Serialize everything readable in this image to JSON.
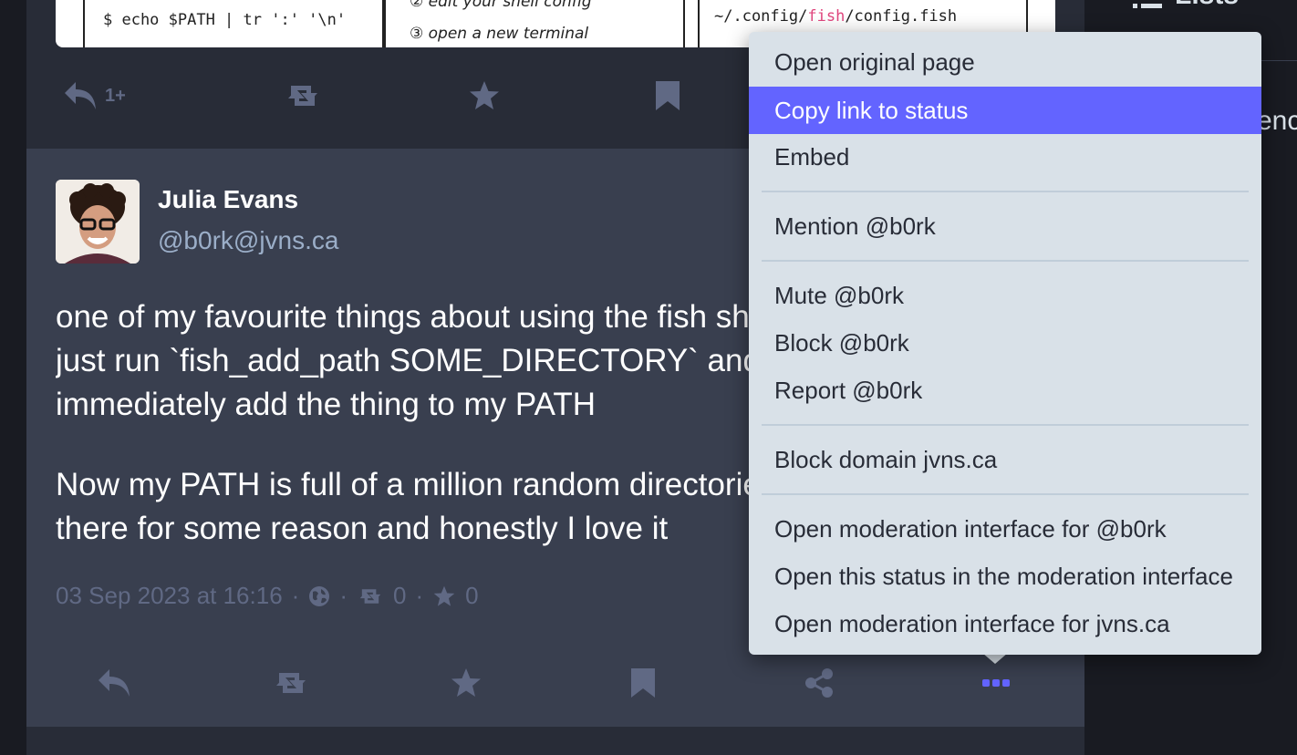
{
  "right_sidebar": {
    "lists_label": "Lists",
    "peek_text": "enc"
  },
  "media_card": {
    "panel1_code": "$ echo $PATH | tr ':' '\\n'",
    "panel2_line1": "② edit your shell config",
    "panel2_line2": "③ open a new terminal",
    "panel3_prefix": "~/.config/",
    "panel3_fish": "fish",
    "panel3_suffix": "/config.fish"
  },
  "prev_actions": {
    "reply_count": "1+"
  },
  "status": {
    "display_name": "Julia Evans",
    "account": "@b0rk@jvns.ca",
    "paragraph1_lines": [
      "one of my favourite things about using the fish shell is that I can",
      "just run `fish_add_path SOME_DIRECTORY` and it'll",
      "immediately add the thing to my PATH"
    ],
    "paragraph2_lines": [
      "Now my PATH is full of a million random directories that are in",
      "there for some reason and honestly I love it"
    ],
    "timestamp": "03 Sep 2023 at 16:16",
    "separator": "·",
    "boost_count": "0",
    "fav_count": "0"
  },
  "dropdown": {
    "items": [
      {
        "label": "Open original page",
        "active": false
      },
      {
        "label": "Copy link to status",
        "active": true
      },
      {
        "label": "Embed",
        "active": false
      },
      {
        "label": "Mention @b0rk",
        "active": false
      },
      {
        "label": "Mute @b0rk",
        "active": false
      },
      {
        "label": "Block @b0rk",
        "active": false
      },
      {
        "label": "Report @b0rk",
        "active": false
      },
      {
        "label": "Block domain jvns.ca",
        "active": false
      },
      {
        "label": "Open moderation interface for @b0rk",
        "active": false
      },
      {
        "label": "Open this status in the moderation interface",
        "active": false
      },
      {
        "label": "Open moderation interface for jvns.ca",
        "active": false
      }
    ]
  },
  "colors": {
    "accent": "#6364ff",
    "icon_muted": "#606984",
    "status_bg": "#393f4f",
    "column_bg": "#282c37",
    "page_bg": "#191b22",
    "dropdown_bg": "#d9e1e8",
    "fish_pink": "#e0467e"
  }
}
